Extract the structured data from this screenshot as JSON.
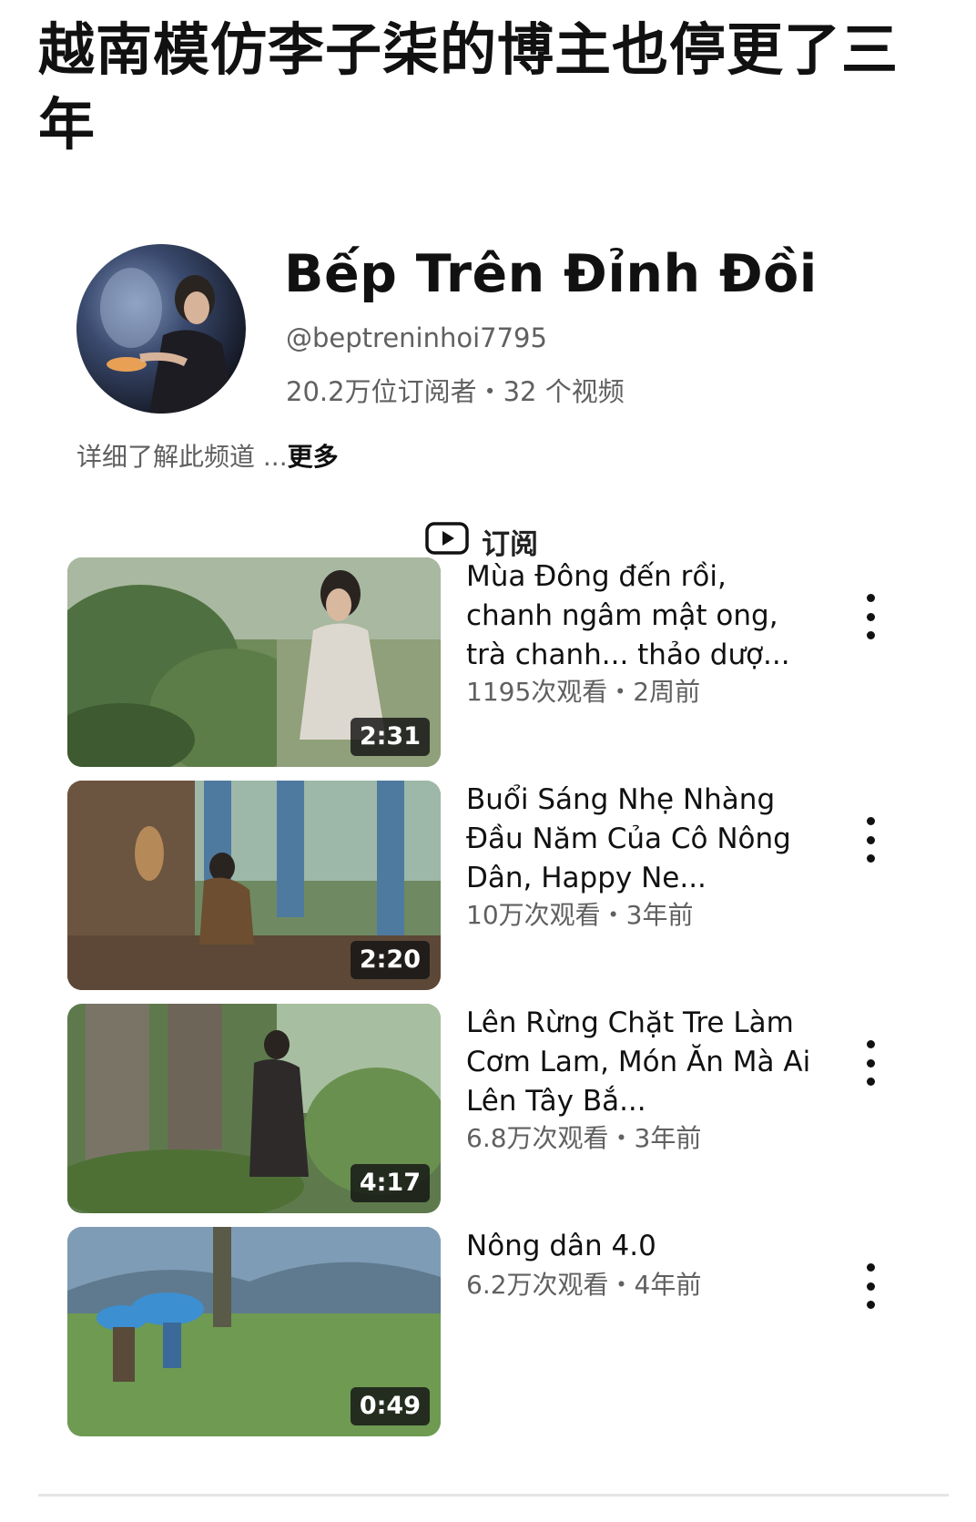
{
  "post_title": "越南模仿李子柒的博主也停更了三年",
  "channel": {
    "name": "Bếp Trên Đỉnh Đồi",
    "handle": "@beptreninhoi7795",
    "stats": "20.2万位订阅者・32 个视频",
    "description": "详细了解此频道 ...",
    "more_label": "更多",
    "subscribe_label": "订阅",
    "subscribe_icon": "youtube-play-icon"
  },
  "videos": [
    {
      "title": "Mùa Đông đến rồi, chanh ngâm mật ong, trà chanh... thảo dượ...",
      "meta": "1195次观看・2周前",
      "duration": "2:31"
    },
    {
      "title": "Buổi Sáng Nhẹ Nhàng Đầu Năm Của Cô Nông Dân, Happy Ne...",
      "meta": "10万次观看・3年前",
      "duration": "2:20"
    },
    {
      "title": "Lên Rừng Chặt Tre Làm Cơm Lam, Món Ăn Mà Ai Lên Tây Bắ...",
      "meta": "6.8万次观看・3年前",
      "duration": "4:17"
    },
    {
      "title": "Nông dân 4.0",
      "meta": "6.2万次观看・4年前",
      "duration": "0:49"
    }
  ],
  "colors": {
    "text_primary": "#0f0f0f",
    "text_secondary": "#606060",
    "background": "#ffffff"
  }
}
